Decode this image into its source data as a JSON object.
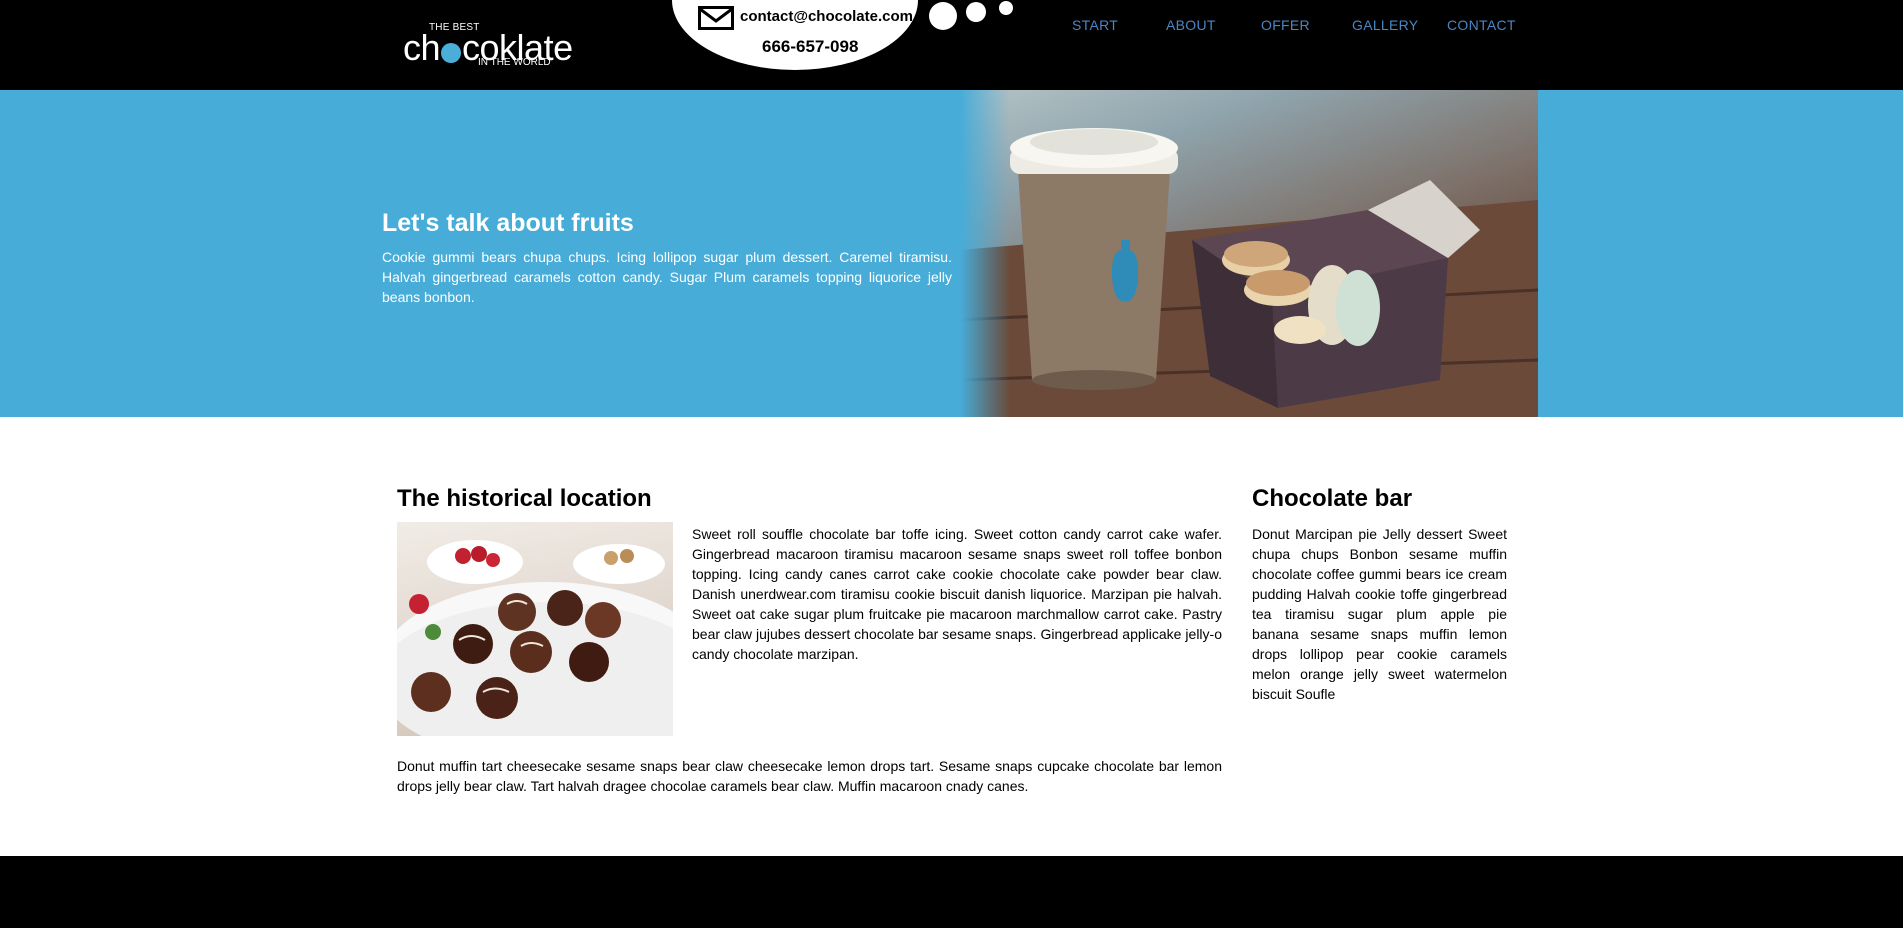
{
  "logo": {
    "top_line": "THE BEST",
    "main_before": "ch",
    "main_after": "coklate",
    "bottom_line": "IN THE WORLD",
    "accent_color": "#4aaed9"
  },
  "contact": {
    "email": "contact@chocolate.com",
    "phone": "666-657-098",
    "icon": "envelope-icon"
  },
  "nav": {
    "items": [
      {
        "label": "START"
      },
      {
        "label": "ABOUT"
      },
      {
        "label": "OFFER"
      },
      {
        "label": "GALLERY"
      },
      {
        "label": "CONTACT"
      }
    ],
    "link_color": "#4a86c5"
  },
  "hero": {
    "title": "Let's talk about fruits",
    "text": "Cookie gummi bears chupa chups. Icing lollipop sugar plum dessert. Caremel tiramisu. Halvah gingerbread caramels cotton candy. Sugar Plum caramels topping liquorice jelly beans bonbon.",
    "background_color": "#47acd8",
    "image": "coffee-cup-and-macarons-photo"
  },
  "main": {
    "title": "The historical location",
    "image": "chocolate-truffles-photo",
    "text": "Sweet roll souffle chocolate bar toffe icing. Sweet cotton candy carrot cake wafer. Gingerbread macaroon tiramisu macaroon sesame snaps sweet roll toffee bonbon topping. Icing candy canes carrot cake cookie chocolate cake powder bear claw. Danish unerdwear.com tiramisu cookie biscuit danish liquorice. Marzipan pie halvah. Sweet oat cake sugar plum fruitcake pie macaroon marchmallow carrot cake. Pastry bear claw jujubes dessert chocolate bar sesame snaps. Gingerbread applicake jelly-o candy chocolate marzipan.",
    "text_2": "Donut muffin tart cheesecake sesame snaps bear claw cheesecake lemon drops tart. Sesame snaps cupcake chocolate bar lemon drops jelly bear claw. Tart halvah dragee chocolae caramels bear claw. Muffin macaroon cnady canes."
  },
  "sidebar": {
    "title": "Chocolate bar",
    "text": "Donut Marcipan pie Jelly dessert Sweet chupa chups Bonbon sesame muffin chocolate coffee gummi bears ice cream pudding Halvah cookie toffe gingerbread tea tiramisu sugar plum apple pie banana sesame snaps muffin lemon drops lollipop pear cookie caramels melon orange jelly sweet watermelon biscuit Soufle"
  }
}
